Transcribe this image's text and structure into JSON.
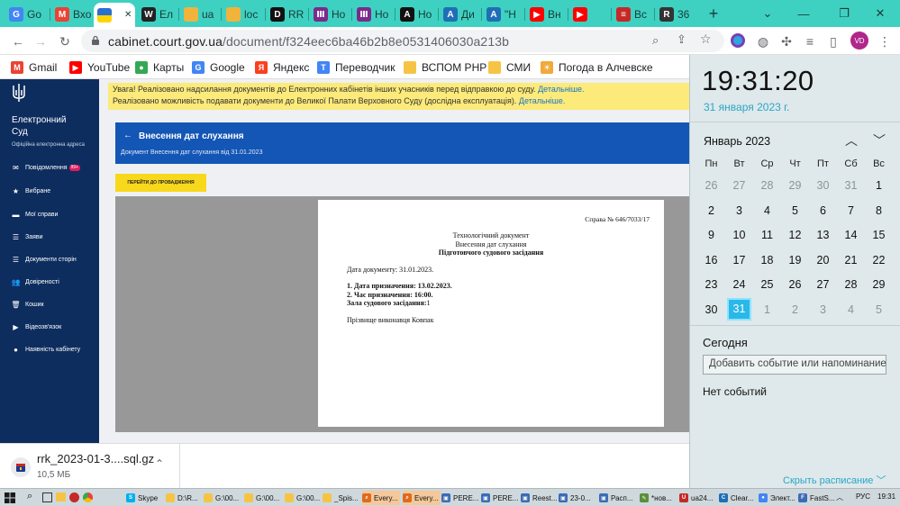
{
  "tabs": [
    {
      "label": "Go",
      "icon": "google-icon",
      "color": "#4285f4",
      "glyph": "G"
    },
    {
      "label": "Вхо",
      "icon": "gmail-icon",
      "color": "#ea4335",
      "glyph": "M"
    },
    {
      "label": "",
      "icon": "ukraine-flag-icon",
      "color": "#ffd500",
      "glyph": ""
    },
    {
      "label": "Ел",
      "icon": "wikipedia-icon",
      "color": "#222222",
      "glyph": "W"
    },
    {
      "label": "ua",
      "icon": "court-icon",
      "color": "#f1b33c",
      "glyph": ""
    },
    {
      "label": "loc",
      "icon": "court-icon",
      "color": "#f1b33c",
      "glyph": ""
    },
    {
      "label": "RR",
      "icon": "d-logo-icon",
      "color": "#111111",
      "glyph": "D"
    },
    {
      "label": "Но",
      "icon": "news-icon",
      "color": "#7a2b8c",
      "glyph": "Ⅲ"
    },
    {
      "label": "Но",
      "icon": "news-icon",
      "color": "#7a2b8c",
      "glyph": "Ⅲ"
    },
    {
      "label": "Но",
      "icon": "a-letter-icon",
      "color": "#111111",
      "glyph": "A"
    },
    {
      "label": "Ди",
      "icon": "a-box-icon",
      "color": "#1f6fb5",
      "glyph": "A"
    },
    {
      "label": "\"Н",
      "icon": "a-box-icon",
      "color": "#1f6fb5",
      "glyph": "A"
    },
    {
      "label": "Вн",
      "icon": "youtube-icon",
      "color": "#ff0000",
      "glyph": "▶"
    },
    {
      "label": "",
      "icon": "youtube-icon",
      "color": "#ff0000",
      "glyph": "▶"
    },
    {
      "label": "Вс",
      "icon": "news-red-icon",
      "color": "#c62828",
      "glyph": "≡"
    },
    {
      "label": "36",
      "icon": "raz-icon",
      "color": "#333333",
      "glyph": "R"
    }
  ],
  "toolbar": {
    "url_domain": "cabinet.court.gov.ua",
    "url_path": "/document/f324eec6ba46b2b8e0531406030a213b",
    "avatar": "VD"
  },
  "bookmarks": [
    {
      "label": "Gmail",
      "icon": "gmail-icon",
      "color": "#ea4335",
      "glyph": "M"
    },
    {
      "label": "YouTube",
      "icon": "youtube-icon",
      "color": "#ff0000",
      "glyph": "▶"
    },
    {
      "label": "Карты",
      "icon": "maps-pin-icon",
      "color": "#34a853",
      "glyph": "●"
    },
    {
      "label": "Google",
      "icon": "google-icon",
      "color": "#4285f4",
      "glyph": "G"
    },
    {
      "label": "Яндекс",
      "icon": "yandex-icon",
      "color": "#fc3f1d",
      "glyph": "Я"
    },
    {
      "label": "Переводчик",
      "icon": "translate-icon",
      "color": "#4285f4",
      "glyph": "T"
    },
    {
      "label": "ВСПОМ РНР",
      "icon": "folder-icon",
      "color": "#f6c445",
      "glyph": ""
    },
    {
      "label": "СМИ",
      "icon": "folder-icon",
      "color": "#f6c445",
      "glyph": ""
    },
    {
      "label": "Погода в Алчевске",
      "icon": "weather-icon",
      "color": "#f0a93b",
      "glyph": "☀"
    }
  ],
  "sidebar": {
    "brand_title": "Електронний Суд",
    "brand_subtitle": "Офіційна електронна адреса",
    "items": [
      {
        "label": "Повідомлення",
        "badge": "99+",
        "icon": "message-icon",
        "glyph": "✉"
      },
      {
        "label": "Вибране",
        "icon": "star-icon",
        "glyph": "★"
      },
      {
        "label": "Мої справи",
        "icon": "folder-icon",
        "glyph": "▬"
      },
      {
        "label": "Заяви",
        "icon": "list-icon",
        "glyph": "☰"
      },
      {
        "label": "Документи сторін",
        "icon": "list-icon",
        "glyph": "☰"
      },
      {
        "label": "Довіреності",
        "icon": "users-icon",
        "glyph": "👥"
      },
      {
        "label": "Кошик",
        "icon": "trash-icon",
        "glyph": "🗑"
      },
      {
        "label": "Відеозв'язок",
        "icon": "video-icon",
        "glyph": "▶"
      },
      {
        "label": "Наявність кабінету",
        "icon": "user-icon",
        "glyph": "●"
      }
    ]
  },
  "notice": {
    "line1": "Увага! Реалізовано надсилання документів до Електронних кабінетів інших учасників перед відправкою до суду.",
    "link1": "Детальніше.",
    "line2": "Реалізовано можливість подавати документи до Великої Палати Верховного Суду (дослідна експлуатація).",
    "link2": "Детальніше."
  },
  "header": {
    "back_glyph": "←",
    "title": "Внесення дат слухання",
    "subtitle": "Документ Внесення дат слухання від 31.01.2023"
  },
  "goto_button": "ПЕРЕЙТИ ДО ПРОВАДЖЕННЯ",
  "document": {
    "case_number": "Справа № 646/7033/17",
    "heading1": "Технологічний документ",
    "heading2": "Внесення дат слухання",
    "heading3": "Підготовчого судового засідання",
    "doc_date": "Дата документу: 31.01.2023.",
    "line1_label": "1. Дата призначення:",
    "line1_value": "13.02.2023.",
    "line2_label": "2. Час призначення:",
    "line2_value": "16:00.",
    "line3_label": "Зала судового засідання:",
    "line3_value": "1",
    "executor": "Прізвище виконавця Ковпак"
  },
  "download": {
    "filename": "rrk_2023-01-3....sql.gz",
    "size": "10,5 МБ"
  },
  "calendar": {
    "time": "19:31:20",
    "date": "31 января 2023 г.",
    "month": "Январь 2023",
    "weekdays": [
      "Пн",
      "Вт",
      "Ср",
      "Чт",
      "Пт",
      "Сб",
      "Вс"
    ],
    "days": [
      {
        "d": "26",
        "dim": true
      },
      {
        "d": "27",
        "dim": true
      },
      {
        "d": "28",
        "dim": true
      },
      {
        "d": "29",
        "dim": true
      },
      {
        "d": "30",
        "dim": true
      },
      {
        "d": "31",
        "dim": true
      },
      {
        "d": "1",
        "dim": false
      },
      {
        "d": "2",
        "dim": false
      },
      {
        "d": "3",
        "dim": false
      },
      {
        "d": "4",
        "dim": false
      },
      {
        "d": "5",
        "dim": false
      },
      {
        "d": "6",
        "dim": false
      },
      {
        "d": "7",
        "dim": false
      },
      {
        "d": "8",
        "dim": false
      },
      {
        "d": "9",
        "dim": false
      },
      {
        "d": "10",
        "dim": false
      },
      {
        "d": "11",
        "dim": false
      },
      {
        "d": "12",
        "dim": false
      },
      {
        "d": "13",
        "dim": false
      },
      {
        "d": "14",
        "dim": false
      },
      {
        "d": "15",
        "dim": false
      },
      {
        "d": "16",
        "dim": false
      },
      {
        "d": "17",
        "dim": false
      },
      {
        "d": "18",
        "dim": false
      },
      {
        "d": "19",
        "dim": false
      },
      {
        "d": "20",
        "dim": false
      },
      {
        "d": "21",
        "dim": false
      },
      {
        "d": "22",
        "dim": false
      },
      {
        "d": "23",
        "dim": false
      },
      {
        "d": "24",
        "dim": false
      },
      {
        "d": "25",
        "dim": false
      },
      {
        "d": "26",
        "dim": false
      },
      {
        "d": "27",
        "dim": false
      },
      {
        "d": "28",
        "dim": false
      },
      {
        "d": "29",
        "dim": false
      },
      {
        "d": "30",
        "dim": false
      },
      {
        "d": "31",
        "dim": false,
        "today": true
      },
      {
        "d": "1",
        "dim": true
      },
      {
        "d": "2",
        "dim": true
      },
      {
        "d": "3",
        "dim": true
      },
      {
        "d": "4",
        "dim": true
      },
      {
        "d": "5",
        "dim": true
      }
    ],
    "today_label": "Сегодня",
    "add_event": "Добавить событие или напоминание",
    "no_events": "Нет событий",
    "schedule_link": "Скрыть расписание"
  },
  "taskbar": {
    "items": [
      {
        "label": "Skype",
        "icon": "skype-icon",
        "color": "#00aff0",
        "glyph": "S"
      },
      {
        "label": "D:\\R...",
        "icon": "folder-icon",
        "color": "#f6c445",
        "glyph": ""
      },
      {
        "label": "G:\\00...",
        "icon": "folder-icon",
        "color": "#f6c445",
        "glyph": ""
      },
      {
        "label": "G:\\00...",
        "icon": "folder-icon",
        "color": "#f6c445",
        "glyph": ""
      },
      {
        "label": "G:\\00...",
        "icon": "folder-icon",
        "color": "#f6c445",
        "glyph": ""
      },
      {
        "label": "_Spis...",
        "icon": "folder-icon",
        "color": "#f6c445",
        "glyph": ""
      },
      {
        "label": "Every...",
        "icon": "search-app-icon",
        "color": "#e06a1b",
        "glyph": "⌕",
        "hl": true
      },
      {
        "label": "Every...",
        "icon": "search-app-icon",
        "color": "#e06a1b",
        "glyph": "⌕",
        "hl": true
      },
      {
        "label": "PERE...",
        "icon": "window-icon",
        "color": "#3b6bb5",
        "glyph": "▣"
      },
      {
        "label": "PERE...",
        "icon": "window-icon",
        "color": "#3b6bb5",
        "glyph": "▣"
      },
      {
        "label": "Reest...",
        "icon": "window-icon",
        "color": "#3b6bb5",
        "glyph": "▣"
      },
      {
        "label": "23-0...",
        "icon": "window-icon",
        "color": "#3b6bb5",
        "glyph": "▣"
      },
      {
        "label": "Расп...",
        "icon": "window-icon",
        "color": "#3b6bb5",
        "glyph": "▣"
      },
      {
        "label": "*нов...",
        "icon": "notepad-icon",
        "color": "#5a8f3a",
        "glyph": "✎"
      },
      {
        "label": "ua24...",
        "icon": "ua24-icon",
        "color": "#c62828",
        "glyph": "U"
      },
      {
        "label": "Clear...",
        "icon": "clear-icon",
        "color": "#1f6fb5",
        "glyph": "C"
      },
      {
        "label": "Элект...",
        "icon": "chrome-icon",
        "color": "#4285f4",
        "glyph": "●"
      },
      {
        "label": "FastS...",
        "icon": "fast-icon",
        "color": "#3b6bb5",
        "glyph": "F"
      }
    ],
    "lang": "РУС",
    "clock": "19:31"
  }
}
